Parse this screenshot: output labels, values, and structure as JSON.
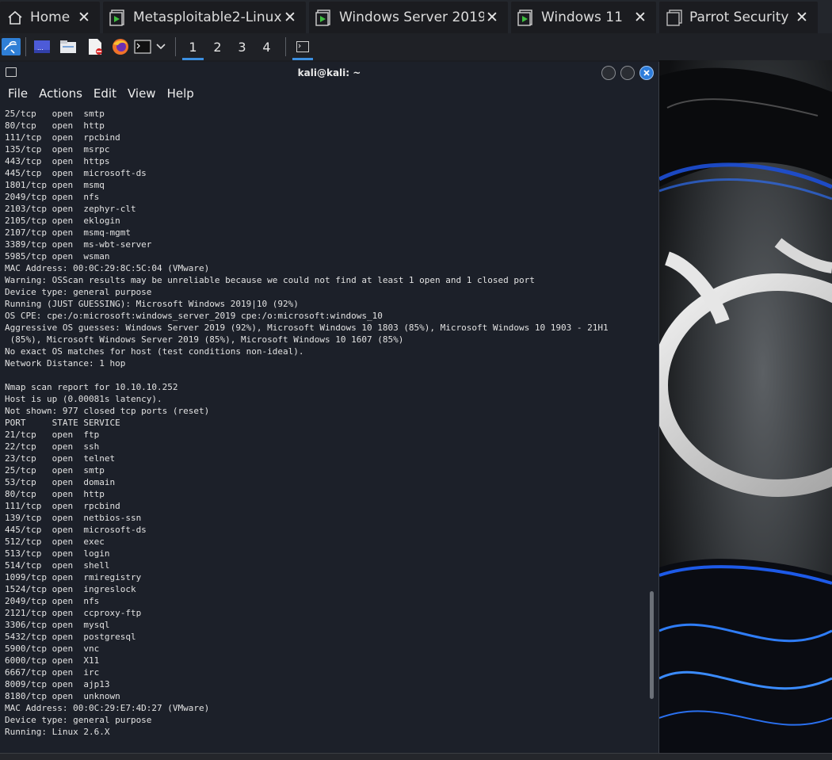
{
  "vm_tabs": [
    {
      "label": "Home",
      "icon": "home-icon"
    },
    {
      "label": "Metasploitable2-Linux",
      "icon": "vm-running-icon"
    },
    {
      "label": "Windows Server 2019",
      "icon": "vm-running-icon"
    },
    {
      "label": "Windows 11",
      "icon": "vm-running-icon"
    },
    {
      "label": "Parrot Security",
      "icon": "vm-off-icon"
    }
  ],
  "panel": {
    "workspaces": [
      "1",
      "2",
      "3",
      "4"
    ],
    "active_workspace": "1",
    "launchers": [
      "kali-menu-icon",
      "desktop-icon",
      "file-manager-icon",
      "text-editor-icon",
      "firefox-icon",
      "terminal-icon"
    ]
  },
  "terminal": {
    "title": "kali@kali: ~",
    "menu": [
      "File",
      "Actions",
      "Edit",
      "View",
      "Help"
    ],
    "lines": [
      "25/tcp   open  smtp",
      "80/tcp   open  http",
      "111/tcp  open  rpcbind",
      "135/tcp  open  msrpc",
      "443/tcp  open  https",
      "445/tcp  open  microsoft-ds",
      "1801/tcp open  msmq",
      "2049/tcp open  nfs",
      "2103/tcp open  zephyr-clt",
      "2105/tcp open  eklogin",
      "2107/tcp open  msmq-mgmt",
      "3389/tcp open  ms-wbt-server",
      "5985/tcp open  wsman",
      "MAC Address: 00:0C:29:8C:5C:04 (VMware)",
      "Warning: OSScan results may be unreliable because we could not find at least 1 open and 1 closed port",
      "Device type: general purpose",
      "Running (JUST GUESSING): Microsoft Windows 2019|10 (92%)",
      "OS CPE: cpe:/o:microsoft:windows_server_2019 cpe:/o:microsoft:windows_10",
      "Aggressive OS guesses: Windows Server 2019 (92%), Microsoft Windows 10 1803 (85%), Microsoft Windows 10 1903 - 21H1",
      " (85%), Microsoft Windows Server 2019 (85%), Microsoft Windows 10 1607 (85%)",
      "No exact OS matches for host (test conditions non-ideal).",
      "Network Distance: 1 hop",
      "",
      "Nmap scan report for 10.10.10.252",
      "Host is up (0.00081s latency).",
      "Not shown: 977 closed tcp ports (reset)",
      "PORT     STATE SERVICE",
      "21/tcp   open  ftp",
      "22/tcp   open  ssh",
      "23/tcp   open  telnet",
      "25/tcp   open  smtp",
      "53/tcp   open  domain",
      "80/tcp   open  http",
      "111/tcp  open  rpcbind",
      "139/tcp  open  netbios-ssn",
      "445/tcp  open  microsoft-ds",
      "512/tcp  open  exec",
      "513/tcp  open  login",
      "514/tcp  open  shell",
      "1099/tcp open  rmiregistry",
      "1524/tcp open  ingreslock",
      "2049/tcp open  nfs",
      "2121/tcp open  ccproxy-ftp",
      "3306/tcp open  mysql",
      "5432/tcp open  postgresql",
      "5900/tcp open  vnc",
      "6000/tcp open  X11",
      "6667/tcp open  irc",
      "8009/tcp open  ajp13",
      "8180/tcp open  unknown",
      "MAC Address: 00:0C:29:E7:4D:27 (VMware)",
      "Device type: general purpose",
      "Running: Linux 2.6.X"
    ]
  },
  "colors": {
    "terminal_bg": "#1c2029",
    "accent": "#3c8fe0",
    "close_button": "#2e7ddb"
  }
}
